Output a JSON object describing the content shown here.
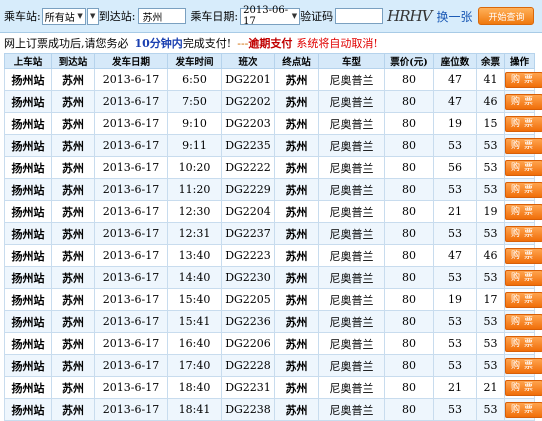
{
  "search": {
    "origin_label": "乘车站:",
    "origin_value": "所有站",
    "dest_label": "到达站:",
    "dest_value": "苏州",
    "date_label": "乘车日期:",
    "date_value": "2013-06-17",
    "captcha_label": "验证码",
    "captcha_value": "",
    "captcha_image_text": "HRHV",
    "refresh_label": "换一张",
    "search_button": "开始查询"
  },
  "notice": {
    "part1": "网上订票成功后,请您务必",
    "highlight": "10分钟内",
    "part2": "完成支付!",
    "dashes": "---",
    "overdue": "逾期支付",
    "cancel": "系统将自动取消!"
  },
  "table": {
    "headers": [
      "上车站",
      "到达站",
      "发车日期",
      "发车时间",
      "班次",
      "终点站",
      "车型",
      "票价(元)",
      "座位数",
      "余票",
      "操作"
    ],
    "rows": [
      {
        "from": "扬州站",
        "to": "苏州",
        "date": "2013-6-17",
        "time": "6:50",
        "train": "DG2201",
        "terminal": "苏州",
        "type": "尼奥普兰",
        "price": "80",
        "seats": "47",
        "left": "41",
        "action": "购票"
      },
      {
        "from": "扬州站",
        "to": "苏州",
        "date": "2013-6-17",
        "time": "7:50",
        "train": "DG2202",
        "terminal": "苏州",
        "type": "尼奥普兰",
        "price": "80",
        "seats": "47",
        "left": "46",
        "action": "购票"
      },
      {
        "from": "扬州站",
        "to": "苏州",
        "date": "2013-6-17",
        "time": "9:10",
        "train": "DG2203",
        "terminal": "苏州",
        "type": "尼奥普兰",
        "price": "80",
        "seats": "19",
        "left": "15",
        "action": "购票"
      },
      {
        "from": "扬州站",
        "to": "苏州",
        "date": "2013-6-17",
        "time": "9:11",
        "train": "DG2235",
        "terminal": "苏州",
        "type": "尼奥普兰",
        "price": "80",
        "seats": "53",
        "left": "53",
        "action": "购票"
      },
      {
        "from": "扬州站",
        "to": "苏州",
        "date": "2013-6-17",
        "time": "10:20",
        "train": "DG2222",
        "terminal": "苏州",
        "type": "尼奥普兰",
        "price": "80",
        "seats": "56",
        "left": "53",
        "action": "购票"
      },
      {
        "from": "扬州站",
        "to": "苏州",
        "date": "2013-6-17",
        "time": "11:20",
        "train": "DG2229",
        "terminal": "苏州",
        "type": "尼奥普兰",
        "price": "80",
        "seats": "53",
        "left": "53",
        "action": "购票"
      },
      {
        "from": "扬州站",
        "to": "苏州",
        "date": "2013-6-17",
        "time": "12:30",
        "train": "DG2204",
        "terminal": "苏州",
        "type": "尼奥普兰",
        "price": "80",
        "seats": "21",
        "left": "19",
        "action": "购票"
      },
      {
        "from": "扬州站",
        "to": "苏州",
        "date": "2013-6-17",
        "time": "12:31",
        "train": "DG2237",
        "terminal": "苏州",
        "type": "尼奥普兰",
        "price": "80",
        "seats": "53",
        "left": "53",
        "action": "购票"
      },
      {
        "from": "扬州站",
        "to": "苏州",
        "date": "2013-6-17",
        "time": "13:40",
        "train": "DG2223",
        "terminal": "苏州",
        "type": "尼奥普兰",
        "price": "80",
        "seats": "47",
        "left": "46",
        "action": "购票"
      },
      {
        "from": "扬州站",
        "to": "苏州",
        "date": "2013-6-17",
        "time": "14:40",
        "train": "DG2230",
        "terminal": "苏州",
        "type": "尼奥普兰",
        "price": "80",
        "seats": "53",
        "left": "53",
        "action": "购票"
      },
      {
        "from": "扬州站",
        "to": "苏州",
        "date": "2013-6-17",
        "time": "15:40",
        "train": "DG2205",
        "terminal": "苏州",
        "type": "尼奥普兰",
        "price": "80",
        "seats": "19",
        "left": "17",
        "action": "购票"
      },
      {
        "from": "扬州站",
        "to": "苏州",
        "date": "2013-6-17",
        "time": "15:41",
        "train": "DG2236",
        "terminal": "苏州",
        "type": "尼奥普兰",
        "price": "80",
        "seats": "53",
        "left": "53",
        "action": "购票"
      },
      {
        "from": "扬州站",
        "to": "苏州",
        "date": "2013-6-17",
        "time": "16:40",
        "train": "DG2206",
        "terminal": "苏州",
        "type": "尼奥普兰",
        "price": "80",
        "seats": "53",
        "left": "53",
        "action": "购票"
      },
      {
        "from": "扬州站",
        "to": "苏州",
        "date": "2013-6-17",
        "time": "17:40",
        "train": "DG2228",
        "terminal": "苏州",
        "type": "尼奥普兰",
        "price": "80",
        "seats": "53",
        "left": "53",
        "action": "购票"
      },
      {
        "from": "扬州站",
        "to": "苏州",
        "date": "2013-6-17",
        "time": "18:40",
        "train": "DG2231",
        "terminal": "苏州",
        "type": "尼奥普兰",
        "price": "80",
        "seats": "21",
        "left": "21",
        "action": "购票"
      },
      {
        "from": "扬州站",
        "to": "苏州",
        "date": "2013-6-17",
        "time": "18:41",
        "train": "DG2238",
        "terminal": "苏州",
        "type": "尼奥普兰",
        "price": "80",
        "seats": "53",
        "left": "53",
        "action": "购票"
      }
    ]
  }
}
